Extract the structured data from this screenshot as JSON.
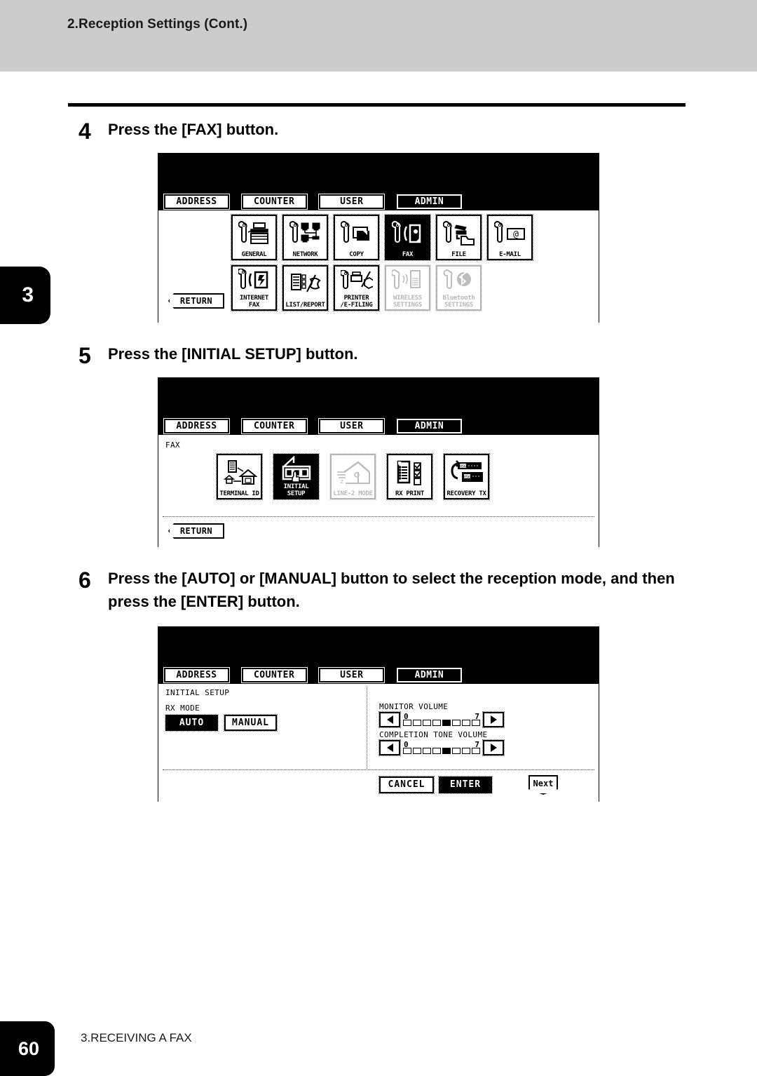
{
  "header": {
    "title": "2.Reception Settings (Cont.)"
  },
  "chapter_tab": {
    "number": "3"
  },
  "footer": {
    "page_number": "60",
    "section_label": "3.RECEIVING A FAX"
  },
  "steps": [
    {
      "number": "4",
      "text": "Press the [FAX] button."
    },
    {
      "number": "5",
      "text": "Press the [INITIAL SETUP] button."
    },
    {
      "number": "6",
      "text": "Press the [AUTO] or [MANUAL] button to select the reception mode, and then press the [ENTER] button."
    }
  ],
  "panels": {
    "tabs": [
      {
        "label": "ADDRESS",
        "selected": false
      },
      {
        "label": "COUNTER",
        "selected": false
      },
      {
        "label": "USER",
        "selected": false
      },
      {
        "label": "ADMIN",
        "selected": true
      }
    ],
    "panel1": {
      "row1": [
        {
          "label": "GENERAL",
          "icon": "wrench-printer-icon",
          "state": "normal"
        },
        {
          "label": "NETWORK",
          "icon": "wrench-network-icon",
          "state": "normal"
        },
        {
          "label": "COPY",
          "icon": "wrench-page-icon",
          "state": "normal"
        },
        {
          "label": "FAX",
          "icon": "wrench-fax-icon",
          "state": "selected"
        },
        {
          "label": "FILE",
          "icon": "wrench-file-folder-icon",
          "state": "normal"
        },
        {
          "label": "E-MAIL",
          "icon": "wrench-envelope-at-icon",
          "state": "normal"
        }
      ],
      "row2": [
        {
          "label": "INTERNET FAX",
          "icon": "wrench-internet-fax-icon",
          "state": "normal"
        },
        {
          "label": "LIST/REPORT",
          "icon": "wrench-list-report-icon",
          "state": "normal"
        },
        {
          "label": "PRINTER\n/E-FILING",
          "icon": "wrench-printer-efiling-icon",
          "state": "normal"
        },
        {
          "label": "WIRELESS\nSETTINGS",
          "icon": "wrench-wireless-icon",
          "state": "disabled"
        },
        {
          "label": "Bluetooth\nSETTINGS",
          "icon": "wrench-bluetooth-icon",
          "state": "disabled"
        }
      ],
      "return_label": "RETURN"
    },
    "panel2": {
      "breadcrumb": "FAX",
      "buttons": [
        {
          "label": "TERMINAL ID",
          "icon": "building-house-icon",
          "state": "normal"
        },
        {
          "label": "INITIAL SETUP",
          "icon": "house-hand-panel-icon",
          "state": "selected"
        },
        {
          "label": "LINE-2 MODE",
          "icon": "house-line2-icon",
          "state": "disabled"
        },
        {
          "label": "RX PRINT",
          "icon": "document-checklist-icon",
          "state": "normal"
        },
        {
          "label": "RECOVERY TX",
          "icon": "recovery-tx-icon",
          "state": "normal"
        }
      ],
      "return_label": "RETURN"
    },
    "panel3": {
      "breadcrumb": "INITIAL SETUP",
      "rx_mode_label": "RX MODE",
      "rx_mode_options": [
        {
          "label": "AUTO",
          "selected": true
        },
        {
          "label": "MANUAL",
          "selected": false
        }
      ],
      "sliders": [
        {
          "label": "MONITOR VOLUME",
          "min": "0",
          "max": "7",
          "value": 4,
          "segments": 8
        },
        {
          "label": "COMPLETION TONE VOLUME",
          "min": "0",
          "max": "7",
          "value": 4,
          "segments": 8
        }
      ],
      "actions": [
        {
          "label": "CANCEL",
          "selected": false
        },
        {
          "label": "ENTER",
          "selected": true
        }
      ],
      "next_label": "Next"
    }
  },
  "colors": {
    "header_band": "#cccccc",
    "ink": "#000000",
    "paper": "#ffffff",
    "disabled": "#bdbdbd"
  }
}
